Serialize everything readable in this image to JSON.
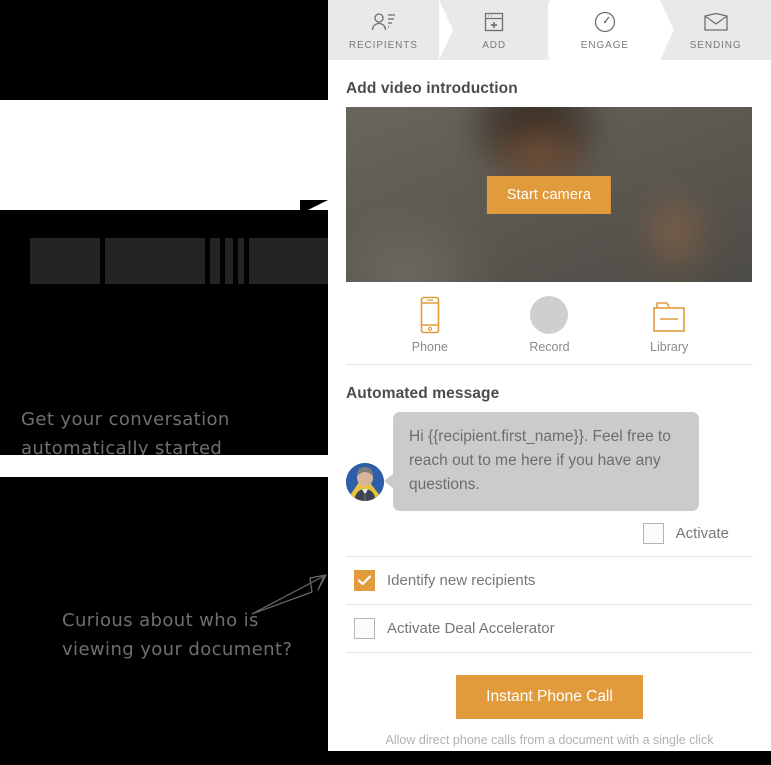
{
  "colors": {
    "accent": "#e29b3c",
    "panel_bg": "#ffffff",
    "step_bar_bg": "#e9e9e9",
    "bubble_bg": "#cbcbcb",
    "text_muted": "#8a8a8a"
  },
  "document_backdrop": {
    "caption_top": "Get your conversation\nautomatically started",
    "caption_bottom": "Curious about who is\nviewing your document?",
    "arrow_icon": "paper-plane-arrow-icon"
  },
  "steps": [
    {
      "label": "RECIPIENTS",
      "icon": "contact-card-icon",
      "active": false
    },
    {
      "label": "ADD",
      "icon": "add-window-icon",
      "active": false
    },
    {
      "label": "ENGAGE",
      "icon": "gauge-icon",
      "active": true
    },
    {
      "label": "SENDING",
      "icon": "envelope-icon",
      "active": false
    }
  ],
  "video_section": {
    "title": "Add video introduction",
    "start_camera_label": "Start camera",
    "media_actions": [
      {
        "label": "Phone",
        "icon": "phone-icon"
      },
      {
        "label": "Record",
        "icon": "record-circle-icon"
      },
      {
        "label": "Library",
        "icon": "folder-icon"
      }
    ]
  },
  "message_section": {
    "title": "Automated message",
    "avatar": "user-avatar",
    "message_text": "Hi {{recipient.first_name}}. Feel free to reach out to me here if you have any questions.",
    "activate_label": "Activate",
    "activate_checked": false
  },
  "options": [
    {
      "label": "Identify new recipients",
      "checked": true
    },
    {
      "label": "Activate Deal Accelerator",
      "checked": false
    }
  ],
  "footer": {
    "button_label": "Instant Phone Call",
    "note": "Allow direct phone calls from a document with a single click"
  }
}
